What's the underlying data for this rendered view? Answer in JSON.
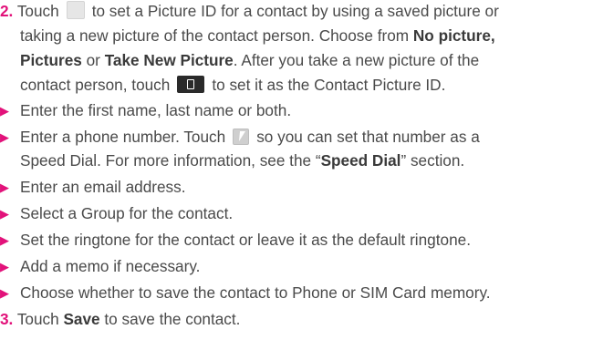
{
  "step2": {
    "number": "2.",
    "line1_a": "Touch",
    "line1_b": "to set a Picture ID for a contact by using a saved picture or",
    "line2": "taking a new picture of the contact person. Choose from",
    "no_picture": "No picture,",
    "pictures": "Pictures",
    "or": "or",
    "take_new": "Take New Picture",
    "line3_end": ". After you take a new picture of the",
    "line4_a": "contact person, touch",
    "line4_b": "to set it as the Contact Picture ID."
  },
  "bullets": {
    "name": "Enter the first name, last name or both.",
    "phone_a": "Enter a phone number. Touch",
    "phone_b": "so you can set that number as a",
    "speed_a": "Speed Dial. For more information, see the “",
    "speed_bold": "Speed Dial",
    "speed_b": "” section.",
    "email": "Enter an email address.",
    "group": "Select a Group for the contact.",
    "ringtone": "Set the ringtone for the contact or leave it as the default ringtone.",
    "memo": "Add a memo if necessary.",
    "memory": "Choose whether to save the contact to Phone or SIM Card memory."
  },
  "step3": {
    "number": "3.",
    "touch": "Touch",
    "save": "Save",
    "rest": "to save the contact."
  },
  "icons": {
    "bullet": "triangle-right-icon",
    "picture_placeholder": "picture-placeholder-icon",
    "contact_picture": "contact-picture-icon",
    "speed_dial": "speed-dial-icon"
  },
  "colors": {
    "accent": "#e2127a",
    "text": "#4a4a4a"
  }
}
